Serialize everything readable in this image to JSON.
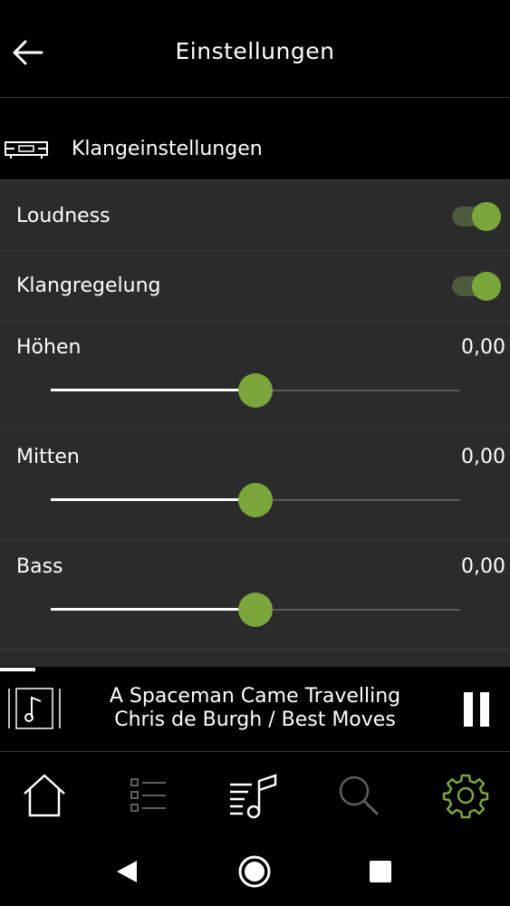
{
  "header": {
    "title": "Einstellungen"
  },
  "section": {
    "title": "Klangeinstellungen"
  },
  "settings": {
    "loudness": {
      "label": "Loudness",
      "enabled": true
    },
    "klangregelung": {
      "label": "Klangregelung",
      "enabled": true
    },
    "hoehen": {
      "label": "Höhen",
      "value": "0,00",
      "level": 0.5
    },
    "mitten": {
      "label": "Mitten",
      "value": "0,00",
      "level": 0.5
    },
    "bass": {
      "label": "Bass",
      "value": "0,00",
      "level": 0.5
    }
  },
  "player": {
    "title": "A Spaceman Came Travelling",
    "subtitle": "Chris de Burgh / Best Moves",
    "progress": 0.07
  },
  "nav": {
    "items": [
      {
        "icon": "home-icon",
        "active": false
      },
      {
        "icon": "list-icon",
        "active": false
      },
      {
        "icon": "music-library-icon",
        "active": false
      },
      {
        "icon": "search-icon",
        "active": false
      },
      {
        "icon": "settings-gear-icon",
        "active": true
      }
    ]
  },
  "colors": {
    "accent": "#7aa63c",
    "panel": "#2b2b2b",
    "background": "#000000"
  }
}
